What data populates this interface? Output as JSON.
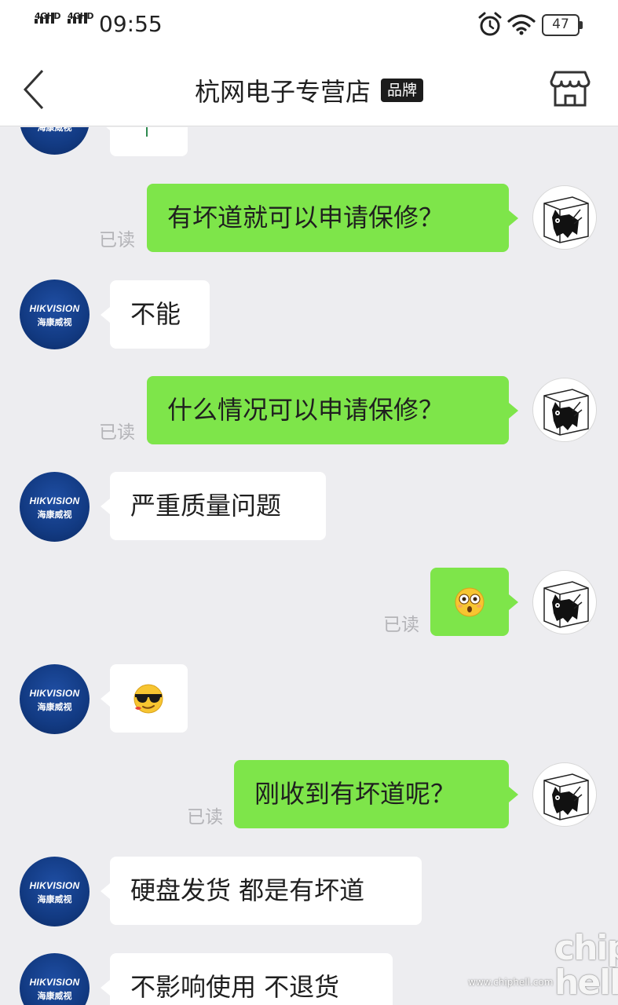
{
  "status_bar": {
    "network1": "4GHD",
    "network2": "4GHD",
    "time": "09:55",
    "battery": "47",
    "icons": [
      "alarm-icon",
      "wifi-icon",
      "battery-icon",
      "signal-icon"
    ]
  },
  "nav": {
    "title": "杭网电子专营店",
    "badge": "品牌",
    "icons": [
      "back-chevron-icon",
      "store-icon"
    ]
  },
  "avatars": {
    "shop_brand": "HIKVISION",
    "shop_brand_cn": "海康威视"
  },
  "messages": [
    {
      "from": "shop",
      "text": ""
    },
    {
      "from": "me",
      "text": "有坏道就可以申请保修？",
      "read": "已读"
    },
    {
      "from": "shop",
      "text": "不能"
    },
    {
      "from": "me",
      "text": "什么情况可以申请保修？",
      "read": "已读"
    },
    {
      "from": "shop",
      "text": "严重质量问题"
    },
    {
      "from": "me",
      "emoji": "flushed-face-emoji",
      "read": "已读"
    },
    {
      "from": "shop",
      "emoji": "sunglasses-face-emoji"
    },
    {
      "from": "me",
      "text": "刚收到有坏道呢？",
      "read": "已读"
    },
    {
      "from": "shop",
      "text": "硬盘发货 都是有坏道"
    },
    {
      "from": "shop",
      "text": "不影响使用 不退货"
    }
  ],
  "watermark": {
    "logo": "chip hell",
    "url": "www.chiphell.com"
  },
  "colors": {
    "sent_bubble": "#7ee54a",
    "received_bubble": "#ffffff",
    "chat_background": "#ededf0",
    "avatar_blue": "#123a82"
  }
}
